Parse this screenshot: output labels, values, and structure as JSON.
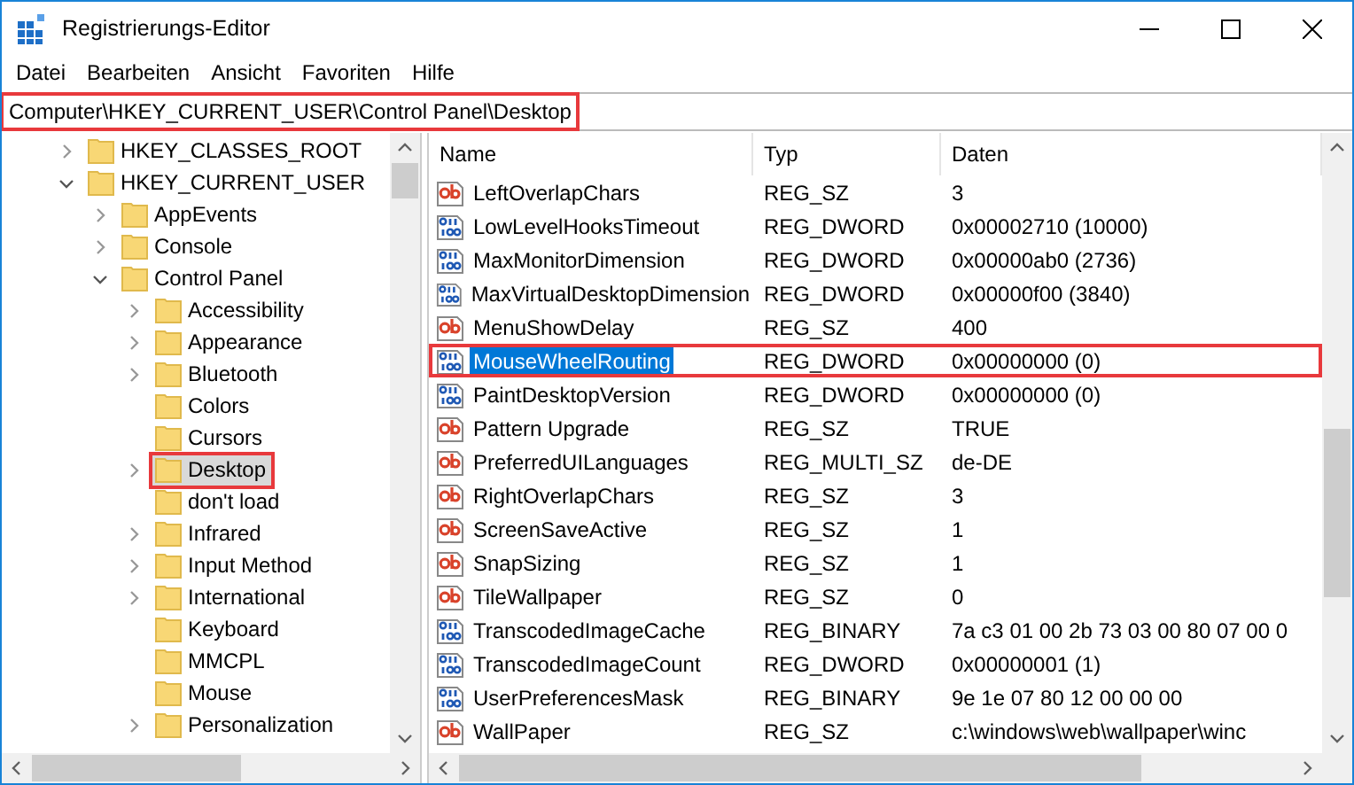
{
  "window": {
    "title": "Registrierungs-Editor"
  },
  "menu": [
    "Datei",
    "Bearbeiten",
    "Ansicht",
    "Favoriten",
    "Hilfe"
  ],
  "address_bar": {
    "value": "Computer\\HKEY_CURRENT_USER\\Control Panel\\Desktop",
    "highlighted": true
  },
  "tree": [
    {
      "label": "HKEY_CLASSES_ROOT",
      "has_children": true,
      "expanded": false,
      "selected": false,
      "highlighted": false
    },
    {
      "label": "HKEY_CURRENT_USER",
      "has_children": true,
      "expanded": true,
      "selected": false,
      "highlighted": false,
      "children": [
        {
          "label": "AppEvents",
          "has_children": true,
          "expanded": false,
          "selected": false,
          "highlighted": false
        },
        {
          "label": "Console",
          "has_children": true,
          "expanded": false,
          "selected": false,
          "highlighted": false
        },
        {
          "label": "Control Panel",
          "has_children": true,
          "expanded": true,
          "selected": false,
          "highlighted": false,
          "children": [
            {
              "label": "Accessibility",
              "has_children": true,
              "expanded": false,
              "selected": false,
              "highlighted": false
            },
            {
              "label": "Appearance",
              "has_children": true,
              "expanded": false,
              "selected": false,
              "highlighted": false
            },
            {
              "label": "Bluetooth",
              "has_children": true,
              "expanded": false,
              "selected": false,
              "highlighted": false
            },
            {
              "label": "Colors",
              "has_children": false,
              "selected": false,
              "highlighted": false
            },
            {
              "label": "Cursors",
              "has_children": false,
              "selected": false,
              "highlighted": false
            },
            {
              "label": "Desktop",
              "has_children": true,
              "expanded": false,
              "selected": true,
              "highlighted": true
            },
            {
              "label": "don't load",
              "has_children": false,
              "selected": false,
              "highlighted": false
            },
            {
              "label": "Infrared",
              "has_children": true,
              "expanded": false,
              "selected": false,
              "highlighted": false
            },
            {
              "label": "Input Method",
              "has_children": true,
              "expanded": false,
              "selected": false,
              "highlighted": false
            },
            {
              "label": "International",
              "has_children": true,
              "expanded": false,
              "selected": false,
              "highlighted": false
            },
            {
              "label": "Keyboard",
              "has_children": false,
              "selected": false,
              "highlighted": false
            },
            {
              "label": "MMCPL",
              "has_children": false,
              "selected": false,
              "highlighted": false
            },
            {
              "label": "Mouse",
              "has_children": false,
              "selected": false,
              "highlighted": false
            },
            {
              "label": "Personalization",
              "has_children": true,
              "expanded": false,
              "selected": false,
              "highlighted": false
            }
          ]
        }
      ]
    }
  ],
  "list": {
    "columns": [
      "Name",
      "Typ",
      "Daten"
    ],
    "rows": [
      {
        "kind": "string",
        "name": "LeftOverlapChars",
        "type": "REG_SZ",
        "data": "3",
        "selected": false,
        "highlighted": false
      },
      {
        "kind": "binary",
        "name": "LowLevelHooksTimeout",
        "type": "REG_DWORD",
        "data": "0x00002710 (10000)",
        "selected": false,
        "highlighted": false
      },
      {
        "kind": "binary",
        "name": "MaxMonitorDimension",
        "type": "REG_DWORD",
        "data": "0x00000ab0 (2736)",
        "selected": false,
        "highlighted": false
      },
      {
        "kind": "binary",
        "name": "MaxVirtualDesktopDimension",
        "type": "REG_DWORD",
        "data": "0x00000f00 (3840)",
        "selected": false,
        "highlighted": false
      },
      {
        "kind": "string",
        "name": "MenuShowDelay",
        "type": "REG_SZ",
        "data": "400",
        "selected": false,
        "highlighted": false
      },
      {
        "kind": "binary",
        "name": "MouseWheelRouting",
        "type": "REG_DWORD",
        "data": "0x00000000 (0)",
        "selected": true,
        "highlighted": true
      },
      {
        "kind": "binary",
        "name": "PaintDesktopVersion",
        "type": "REG_DWORD",
        "data": "0x00000000 (0)",
        "selected": false,
        "highlighted": false
      },
      {
        "kind": "string",
        "name": "Pattern Upgrade",
        "type": "REG_SZ",
        "data": "TRUE",
        "selected": false,
        "highlighted": false
      },
      {
        "kind": "string",
        "name": "PreferredUILanguages",
        "type": "REG_MULTI_SZ",
        "data": "de-DE",
        "selected": false,
        "highlighted": false
      },
      {
        "kind": "string",
        "name": "RightOverlapChars",
        "type": "REG_SZ",
        "data": "3",
        "selected": false,
        "highlighted": false
      },
      {
        "kind": "string",
        "name": "ScreenSaveActive",
        "type": "REG_SZ",
        "data": "1",
        "selected": false,
        "highlighted": false
      },
      {
        "kind": "string",
        "name": "SnapSizing",
        "type": "REG_SZ",
        "data": "1",
        "selected": false,
        "highlighted": false
      },
      {
        "kind": "string",
        "name": "TileWallpaper",
        "type": "REG_SZ",
        "data": "0",
        "selected": false,
        "highlighted": false
      },
      {
        "kind": "binary",
        "name": "TranscodedImageCache",
        "type": "REG_BINARY",
        "data": "7a c3 01 00 2b 73 03 00 80 07 00 0",
        "selected": false,
        "highlighted": false
      },
      {
        "kind": "binary",
        "name": "TranscodedImageCount",
        "type": "REG_DWORD",
        "data": "0x00000001 (1)",
        "selected": false,
        "highlighted": false
      },
      {
        "kind": "binary",
        "name": "UserPreferencesMask",
        "type": "REG_BINARY",
        "data": "9e 1e 07 80 12 00 00 00",
        "selected": false,
        "highlighted": false
      },
      {
        "kind": "string",
        "name": "WallPaper",
        "type": "REG_SZ",
        "data": "c:\\windows\\web\\wallpaper\\winc",
        "selected": false,
        "highlighted": false
      }
    ]
  }
}
